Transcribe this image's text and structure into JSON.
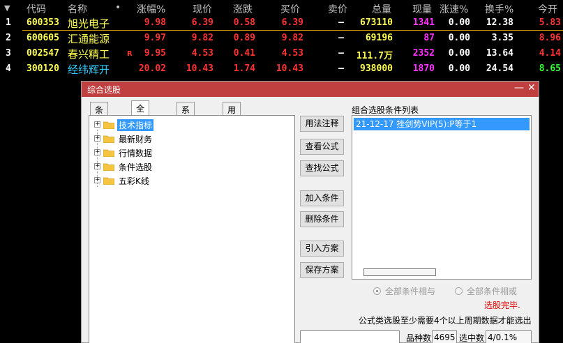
{
  "table": {
    "header_arrow": "▼",
    "columns": [
      "代码",
      "名称",
      "•",
      "涨幅%",
      "现价",
      "涨跌",
      "买价",
      "卖价",
      "总量",
      "现量",
      "涨速%",
      "换手%",
      "今开"
    ],
    "rows": [
      {
        "idx": "1",
        "code": "600353",
        "name": "旭光电子",
        "flag": "",
        "pct": "9.98",
        "price": "6.39",
        "chg": "0.58",
        "bid": "6.39",
        "ask": "–",
        "vol": "673110",
        "cur": "1341",
        "speed": "0.00",
        "turn": "12.38",
        "open": "5.83",
        "name_color": "#ffff55",
        "open_color": "#ff3333"
      },
      {
        "idx": "2",
        "code": "600605",
        "name": "汇通能源",
        "flag": "",
        "pct": "9.97",
        "price": "9.82",
        "chg": "0.89",
        "bid": "9.82",
        "ask": "–",
        "vol": "69196",
        "cur": "87",
        "speed": "0.00",
        "turn": "3.35",
        "open": "8.96",
        "name_color": "#ffff55",
        "open_color": "#ff3333"
      },
      {
        "idx": "3",
        "code": "002547",
        "name": "春兴精工",
        "flag": "R",
        "pct": "9.95",
        "price": "4.53",
        "chg": "0.41",
        "bid": "4.53",
        "ask": "–",
        "vol": "111.7万",
        "cur": "2352",
        "speed": "0.00",
        "turn": "13.64",
        "open": "4.14",
        "name_color": "#ffff55",
        "open_color": "#ff3333"
      },
      {
        "idx": "4",
        "code": "300120",
        "name": "经纬辉开",
        "flag": "",
        "pct": "20.02",
        "price": "10.43",
        "chg": "1.74",
        "bid": "10.43",
        "ask": "–",
        "vol": "938000",
        "cur": "1870",
        "speed": "0.00",
        "turn": "24.54",
        "open": "8.65",
        "name_color": "#33ccff",
        "open_color": "#33ff33"
      }
    ]
  },
  "dialog": {
    "title": "综合选股",
    "minimize": "—",
    "close": "✕",
    "tabs": [
      "条件组",
      "全部条件",
      "系统条件",
      "用户条件"
    ],
    "tree": [
      "技术指标",
      "最新财务",
      "行情数据",
      "条件选股",
      "五彩K线"
    ],
    "buttons": [
      "用法注释",
      "查看公式",
      "查找公式",
      "加入条件",
      "删除条件",
      "引入方案",
      "保存方案"
    ],
    "list_title": "组合选股条件列表",
    "list_items": [
      "21-12-17 挫剑势VIP(5):P等于1"
    ],
    "radio_and": "全部条件相与",
    "radio_or": "全部条件相或",
    "status": "选股完毕.",
    "info": "公式类选股至少需要4个以上周期数据才能选出",
    "count_label": "品种数",
    "count_value": "4695",
    "selected_label": "选中数",
    "selected_value": "4/0.1%"
  },
  "colors": {
    "code": "#ffff55",
    "red": "#ff3333",
    "magenta": "#ff33ff",
    "white": "#ffffff",
    "titlebar": "#c04040",
    "selection": "#3399ff"
  }
}
